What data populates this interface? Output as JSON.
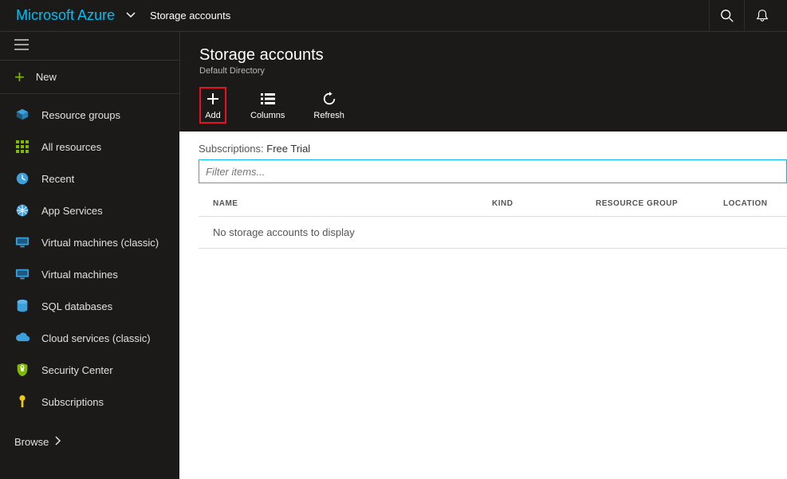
{
  "brand": "Microsoft Azure",
  "breadcrumb": "Storage accounts",
  "sidebar": {
    "new_label": "New",
    "items": [
      {
        "label": "Resource groups",
        "icon": "resource-groups-icon"
      },
      {
        "label": "All resources",
        "icon": "all-resources-icon"
      },
      {
        "label": "Recent",
        "icon": "recent-icon"
      },
      {
        "label": "App Services",
        "icon": "app-services-icon"
      },
      {
        "label": "Virtual machines (classic)",
        "icon": "vm-classic-icon"
      },
      {
        "label": "Virtual machines",
        "icon": "vm-icon"
      },
      {
        "label": "SQL databases",
        "icon": "sql-icon"
      },
      {
        "label": "Cloud services (classic)",
        "icon": "cloud-services-icon"
      },
      {
        "label": "Security Center",
        "icon": "security-icon"
      },
      {
        "label": "Subscriptions",
        "icon": "subscriptions-icon"
      }
    ],
    "browse_label": "Browse"
  },
  "blade": {
    "title": "Storage accounts",
    "subtitle": "Default Directory",
    "toolbar": {
      "add_label": "Add",
      "columns_label": "Columns",
      "refresh_label": "Refresh"
    },
    "subscriptions_label": "Subscriptions:",
    "subscriptions_value": "Free Trial",
    "filter_placeholder": "Filter items...",
    "table": {
      "headers": {
        "name": "NAME",
        "kind": "KIND",
        "resource_group": "RESOURCE GROUP",
        "location": "LOCATION"
      },
      "empty_message": "No storage accounts to display"
    }
  }
}
